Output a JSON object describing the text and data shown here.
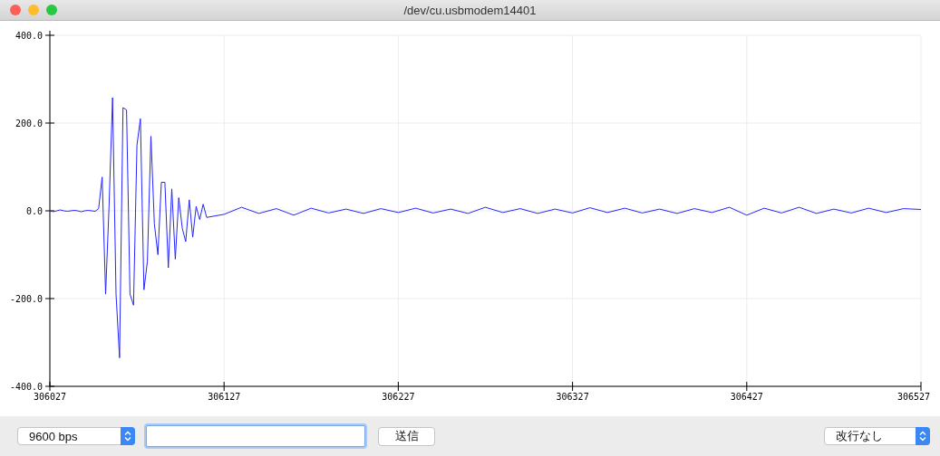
{
  "window": {
    "title": "/dev/cu.usbmodem14401"
  },
  "plot": {
    "chart_data": {
      "type": "line",
      "grid": true,
      "xlim": [
        306027,
        306527
      ],
      "ylim": [
        -400,
        400
      ],
      "xticks": [
        306027,
        306127,
        306227,
        306327,
        306427,
        306527
      ],
      "yticks": [
        {
          "value": -400,
          "label": "-400.0"
        },
        {
          "value": -200,
          "label": "-200.0"
        },
        {
          "value": 0,
          "label": "0.0"
        },
        {
          "value": 200,
          "label": "200.0"
        },
        {
          "value": 400,
          "label": "400.0"
        }
      ],
      "x": [
        306027,
        306029,
        306031,
        306033,
        306035,
        306037,
        306039,
        306041,
        306043,
        306045,
        306047,
        306049,
        306051,
        306053,
        306055,
        306057,
        306059,
        306061,
        306063,
        306065,
        306067,
        306069,
        306071,
        306073,
        306075,
        306077,
        306079,
        306081,
        306083,
        306085,
        306087,
        306089,
        306091,
        306093,
        306095,
        306097,
        306099,
        306101,
        306103,
        306105,
        306107,
        306109,
        306111,
        306113,
        306115,
        306117,
        306127,
        306137,
        306147,
        306157,
        306167,
        306177,
        306187,
        306197,
        306207,
        306217,
        306227,
        306237,
        306247,
        306257,
        306267,
        306277,
        306287,
        306297,
        306307,
        306317,
        306327,
        306337,
        306347,
        306357,
        306367,
        306377,
        306387,
        306397,
        306407,
        306417,
        306427,
        306437,
        306447,
        306457,
        306467,
        306477,
        306487,
        306497,
        306507,
        306517,
        306527
      ],
      "series": [
        {
          "color": "#2424ff",
          "values": [
            0,
            -2,
            0,
            2,
            0,
            -1,
            0,
            1,
            0,
            -2,
            0,
            1,
            0,
            -1,
            5,
            77,
            -190,
            10,
            258,
            -190,
            -335,
            235,
            230,
            -190,
            -215,
            150,
            210,
            -180,
            -115,
            170,
            -30,
            -100,
            65,
            65,
            -130,
            50,
            -110,
            30,
            -40,
            -70,
            25,
            -60,
            10,
            -20,
            15,
            -15,
            -8,
            8,
            -6,
            5,
            -10,
            6,
            -5,
            4,
            -6,
            5,
            -4,
            6,
            -5,
            4,
            -6,
            8,
            -4,
            5,
            -6,
            4,
            -5,
            7,
            -4,
            6,
            -5,
            4,
            -6,
            5,
            -4,
            8,
            -10,
            6,
            -5,
            8,
            -6,
            4,
            -5,
            6,
            -4,
            5,
            3
          ]
        }
      ]
    }
  },
  "controls": {
    "baud": {
      "value": "9600 bps"
    },
    "send": {
      "label": "送信"
    },
    "line_ending": {
      "value": "改行なし"
    }
  }
}
